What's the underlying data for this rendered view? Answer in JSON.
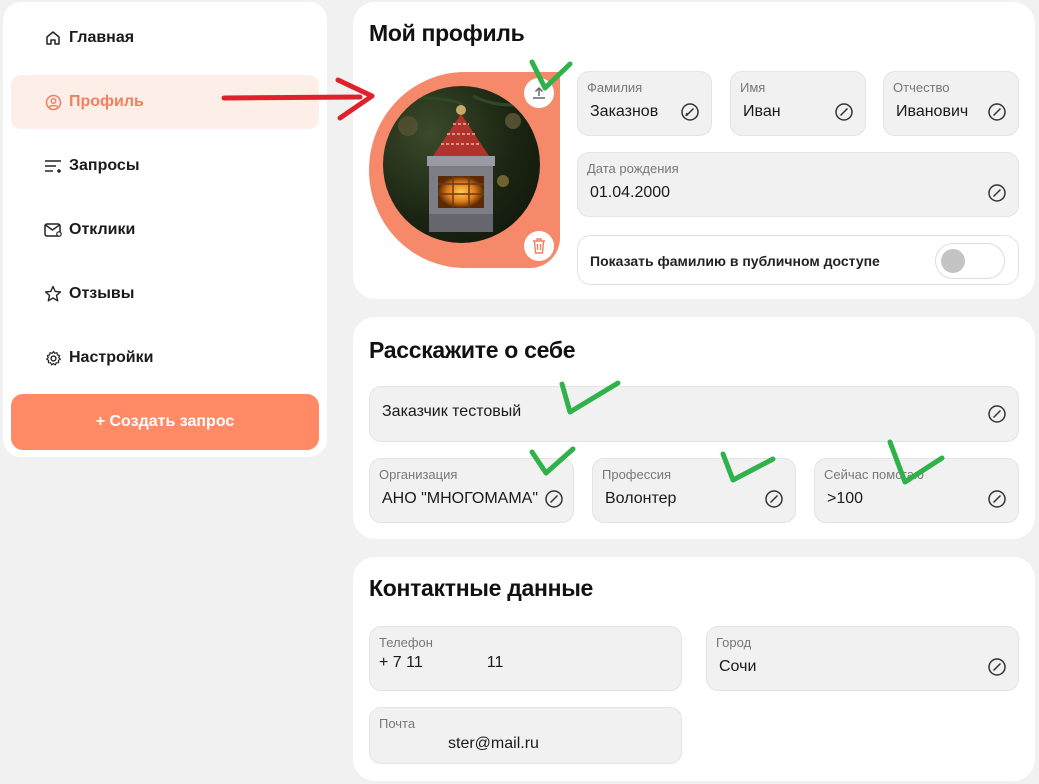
{
  "sidebar": {
    "items": [
      {
        "label": "Главная",
        "icon": "home-icon"
      },
      {
        "label": "Профиль",
        "icon": "profile-icon"
      },
      {
        "label": "Запросы",
        "icon": "requests-icon"
      },
      {
        "label": "Отклики",
        "icon": "responses-icon"
      },
      {
        "label": "Отзывы",
        "icon": "star-icon"
      },
      {
        "label": "Настройки",
        "icon": "gear-icon"
      }
    ],
    "create_label": "+ Создать запрос"
  },
  "profile": {
    "title": "Мой профиль",
    "surname": {
      "label": "Фамилия",
      "value": "Заказнов"
    },
    "name": {
      "label": "Имя",
      "value": "Иван"
    },
    "patronymic": {
      "label": "Отчество",
      "value": "Иванович"
    },
    "birthdate": {
      "label": "Дата рождения",
      "value": "01.04.2000"
    },
    "show_surname": {
      "label": "Показать фамилию в публичном доступе",
      "enabled": false
    }
  },
  "about": {
    "title": "Расскажите о себе",
    "description": "Заказчик тестовый",
    "organization": {
      "label": "Организация",
      "value": "АНО \"МНОГОМАМА\""
    },
    "profession": {
      "label": "Профессия",
      "value": "Волонтер"
    },
    "helped": {
      "label": "Сейчас помогаю",
      "value": ">100"
    }
  },
  "contacts": {
    "title": "Контактные данные",
    "phone": {
      "label": "Телефон",
      "value": "+ 7 11        11"
    },
    "city": {
      "label": "Город",
      "value": "Сочи"
    },
    "email": {
      "label": "Почта",
      "value": "ster@mail.ru"
    }
  },
  "colors": {
    "accent": "#ff8a65",
    "active_bg": "#fdeee8",
    "page_bg": "#f1f1f1"
  }
}
